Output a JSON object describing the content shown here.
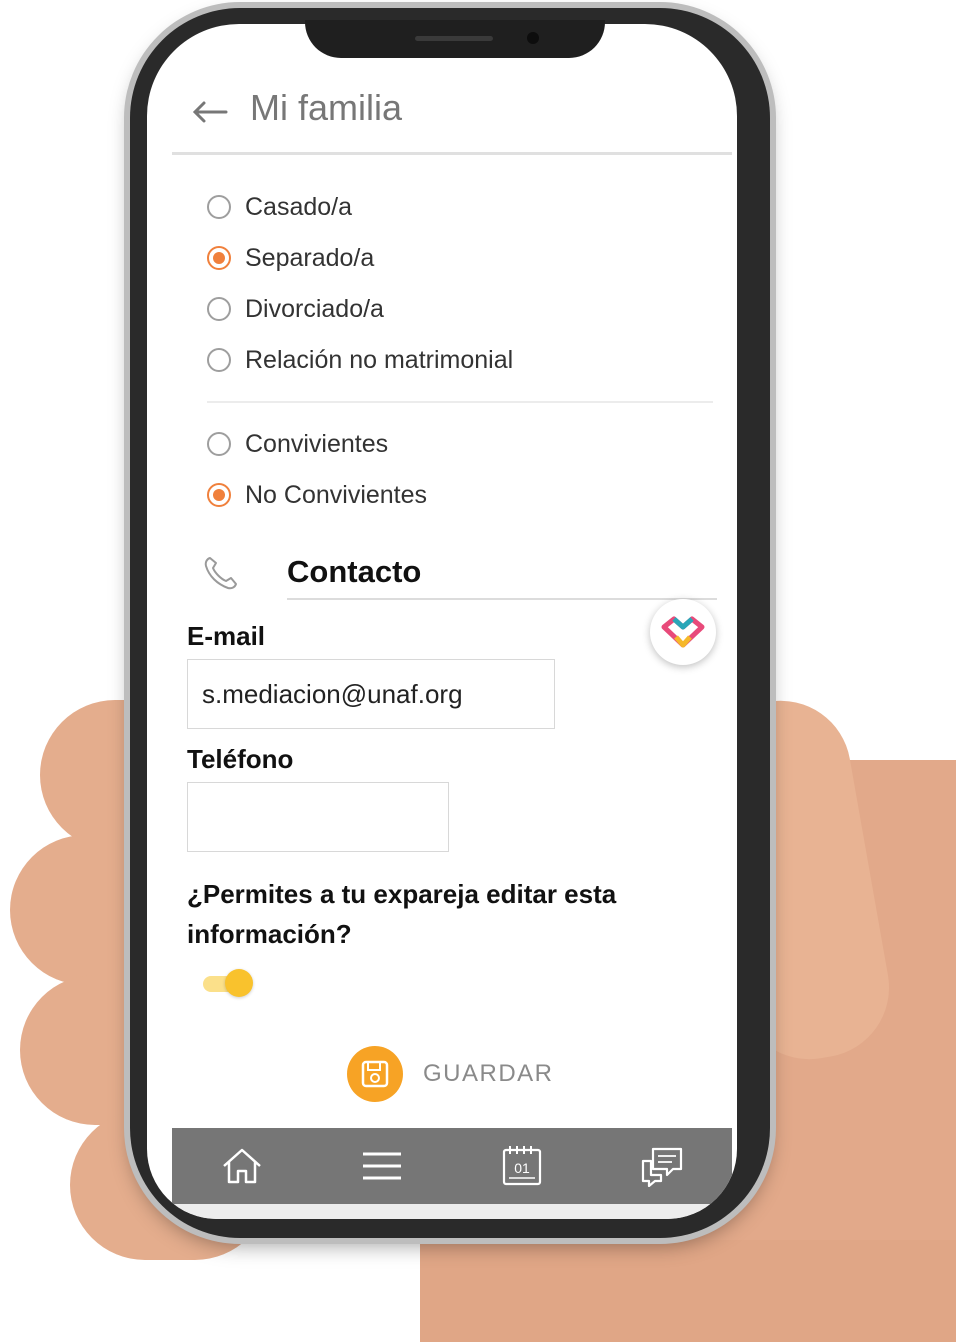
{
  "header": {
    "title": "Mi familia"
  },
  "marital_status": {
    "options": [
      {
        "label": "Casado/a",
        "selected": false
      },
      {
        "label": "Separado/a",
        "selected": true
      },
      {
        "label": "Divorciado/a",
        "selected": false
      },
      {
        "label": "Relación no matrimonial",
        "selected": false
      }
    ]
  },
  "cohabitation": {
    "options": [
      {
        "label": "Convivientes",
        "selected": false
      },
      {
        "label": "No Convivientes",
        "selected": true
      }
    ]
  },
  "contact": {
    "section_title": "Contacto",
    "email_label": "E-mail",
    "email_value": "s.mediacion@unaf.org",
    "phone_label": "Teléfono",
    "phone_value": ""
  },
  "permission": {
    "question": "¿Permites a tu expareja editar esta información?",
    "toggle_on": true
  },
  "actions": {
    "save_label": "GUARDAR"
  },
  "bottom_nav": {
    "items": [
      "home-icon",
      "menu-icon",
      "calendar-icon",
      "chat-icon"
    ],
    "calendar_day": "01"
  },
  "colors": {
    "accent_orange": "#f0803c",
    "save_orange": "#f7a325",
    "toggle_yellow": "#f9c22d",
    "nav_gray": "#767676"
  }
}
